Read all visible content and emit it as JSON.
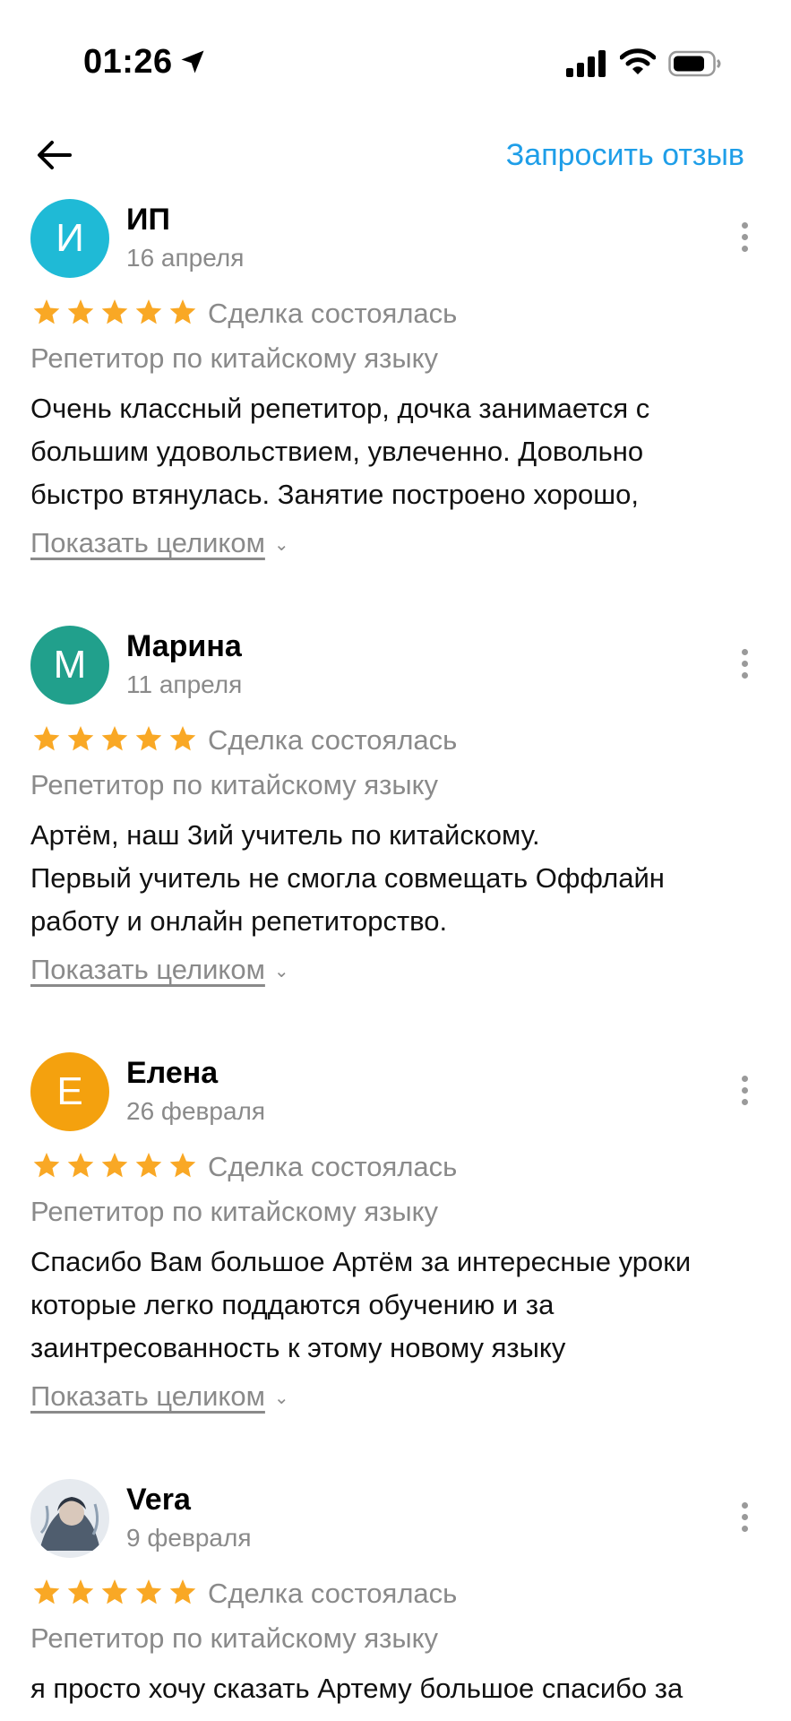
{
  "status_bar": {
    "time": "01:26"
  },
  "nav": {
    "request_review_label": "Запросить отзыв"
  },
  "reviews": [
    {
      "initial": "И",
      "avatar_color": "#1fbad6",
      "author": "ИП",
      "date": "16 апреля",
      "rating": 5,
      "deal": "Сделка состоялась",
      "category": "Репетитор по китайскому языку",
      "lines": [
        "Очень классный репетитор, дочка занимается с",
        "большим удовольствием, увлеченно. Довольно",
        "быстро втянулась. Занятие построено хорошо,"
      ],
      "show_more": "Показать целиком"
    },
    {
      "initial": "М",
      "avatar_color": "#21a08c",
      "author": "Марина",
      "date": "11 апреля",
      "rating": 5,
      "deal": "Сделка состоялась",
      "category": "Репетитор по китайскому языку",
      "lines": [
        "Артём, наш 3ий учитель по китайскому.",
        "Первый учитель не смогла совмещать Оффлайн",
        "работу и онлайн репетиторство."
      ],
      "show_more": "Показать целиком"
    },
    {
      "initial": "Е",
      "avatar_color": "#f4a10e",
      "author": "Елена",
      "date": "26 февраля",
      "rating": 5,
      "deal": "Сделка состоялась",
      "category": "Репетитор по китайскому языку",
      "lines": [
        "Спасибо Вам большое Артём за интересные уроки",
        "которые легко поддаются обучению и за",
        "заинтресованность  к этому  новому языку"
      ],
      "show_more": "Показать целиком"
    },
    {
      "initial": "",
      "avatar_color": "#dde3ea",
      "author": "Vera",
      "date": "9 февраля",
      "rating": 5,
      "deal": "Сделка состоялась",
      "category": "Репетитор по китайскому языку",
      "lines": [
        "я просто хочу сказать Артему большое спасибо за"
      ],
      "show_more": ""
    }
  ]
}
